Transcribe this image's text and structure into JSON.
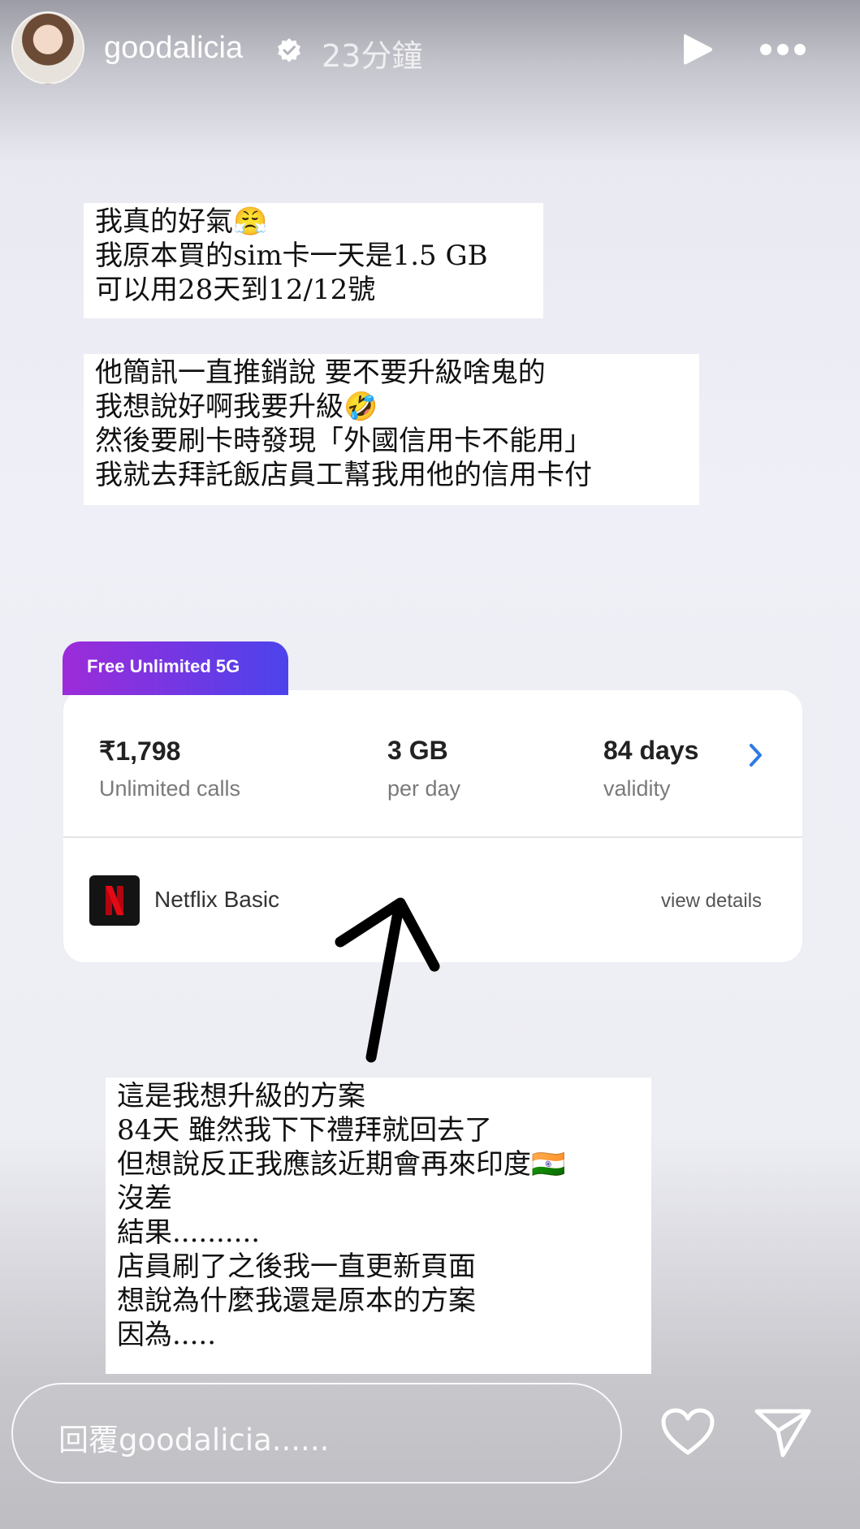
{
  "header": {
    "username": "goodalicia",
    "time": "23分鐘"
  },
  "caption_1": [
    "我真的好氣😤",
    "我原本買的sim卡一天是1.5 GB",
    "可以用28天到12/12號"
  ],
  "caption_2": [
    "他簡訊一直推銷說 要不要升級啥鬼的",
    "我想說好啊我要升級🤣",
    "然後要刷卡時發現「外國信用卡不能用」",
    "我就去拜託飯店員工幫我用他的信用卡付"
  ],
  "plan_card": {
    "tag": "Free Unlimited 5G",
    "price": "₹1,798",
    "price_label": "Unlimited calls",
    "data": "3 GB",
    "data_label": "per day",
    "validity": "84 days",
    "validity_label": "validity",
    "benefit": "Netflix Basic",
    "details_link": "view details",
    "icons": {
      "benefit": "netflix-icon",
      "navigate": "chevron-right-icon"
    },
    "colors": {
      "tag_start": "#9d2bd9",
      "tag_end": "#4c43ec",
      "chevron": "#2d7be5",
      "netflix_red": "#e50914"
    }
  },
  "caption_3": [
    "這是我想升級的方案",
    "84天 雖然我下下禮拜就回去了",
    "但想說反正我應該近期會再來印度🇮🇳",
    "沒差",
    "結果..........",
    "店員刷了之後我一直更新頁面",
    "想說為什麼我還是原本的方案",
    "因為....."
  ],
  "footer": {
    "reply_placeholder": "回覆goodalicia......",
    "icons": [
      "heart-icon",
      "send-icon"
    ]
  }
}
